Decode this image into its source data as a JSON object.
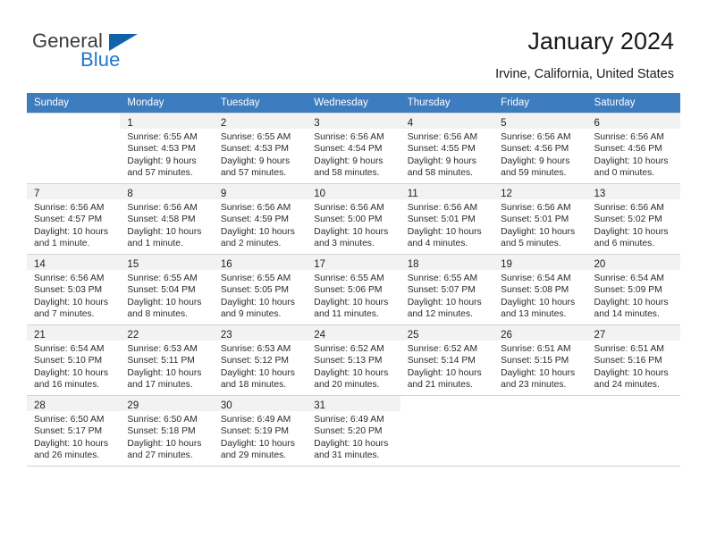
{
  "brand": {
    "name_part1": "General",
    "name_part2": "Blue",
    "flag_icon": "blue-flag-icon"
  },
  "header": {
    "title": "January 2024",
    "location": "Irvine, California, United States"
  },
  "calendar": {
    "weekday_headers": [
      "Sunday",
      "Monday",
      "Tuesday",
      "Wednesday",
      "Thursday",
      "Friday",
      "Saturday"
    ],
    "accent_color": "#3d7cbf",
    "weeks": [
      [
        {
          "day": "",
          "lines": []
        },
        {
          "day": "1",
          "lines": [
            "Sunrise: 6:55 AM",
            "Sunset: 4:53 PM",
            "Daylight: 9 hours",
            "and 57 minutes."
          ]
        },
        {
          "day": "2",
          "lines": [
            "Sunrise: 6:55 AM",
            "Sunset: 4:53 PM",
            "Daylight: 9 hours",
            "and 57 minutes."
          ]
        },
        {
          "day": "3",
          "lines": [
            "Sunrise: 6:56 AM",
            "Sunset: 4:54 PM",
            "Daylight: 9 hours",
            "and 58 minutes."
          ]
        },
        {
          "day": "4",
          "lines": [
            "Sunrise: 6:56 AM",
            "Sunset: 4:55 PM",
            "Daylight: 9 hours",
            "and 58 minutes."
          ]
        },
        {
          "day": "5",
          "lines": [
            "Sunrise: 6:56 AM",
            "Sunset: 4:56 PM",
            "Daylight: 9 hours",
            "and 59 minutes."
          ]
        },
        {
          "day": "6",
          "lines": [
            "Sunrise: 6:56 AM",
            "Sunset: 4:56 PM",
            "Daylight: 10 hours",
            "and 0 minutes."
          ]
        }
      ],
      [
        {
          "day": "7",
          "lines": [
            "Sunrise: 6:56 AM",
            "Sunset: 4:57 PM",
            "Daylight: 10 hours",
            "and 1 minute."
          ]
        },
        {
          "day": "8",
          "lines": [
            "Sunrise: 6:56 AM",
            "Sunset: 4:58 PM",
            "Daylight: 10 hours",
            "and 1 minute."
          ]
        },
        {
          "day": "9",
          "lines": [
            "Sunrise: 6:56 AM",
            "Sunset: 4:59 PM",
            "Daylight: 10 hours",
            "and 2 minutes."
          ]
        },
        {
          "day": "10",
          "lines": [
            "Sunrise: 6:56 AM",
            "Sunset: 5:00 PM",
            "Daylight: 10 hours",
            "and 3 minutes."
          ]
        },
        {
          "day": "11",
          "lines": [
            "Sunrise: 6:56 AM",
            "Sunset: 5:01 PM",
            "Daylight: 10 hours",
            "and 4 minutes."
          ]
        },
        {
          "day": "12",
          "lines": [
            "Sunrise: 6:56 AM",
            "Sunset: 5:01 PM",
            "Daylight: 10 hours",
            "and 5 minutes."
          ]
        },
        {
          "day": "13",
          "lines": [
            "Sunrise: 6:56 AM",
            "Sunset: 5:02 PM",
            "Daylight: 10 hours",
            "and 6 minutes."
          ]
        }
      ],
      [
        {
          "day": "14",
          "lines": [
            "Sunrise: 6:56 AM",
            "Sunset: 5:03 PM",
            "Daylight: 10 hours",
            "and 7 minutes."
          ]
        },
        {
          "day": "15",
          "lines": [
            "Sunrise: 6:55 AM",
            "Sunset: 5:04 PM",
            "Daylight: 10 hours",
            "and 8 minutes."
          ]
        },
        {
          "day": "16",
          "lines": [
            "Sunrise: 6:55 AM",
            "Sunset: 5:05 PM",
            "Daylight: 10 hours",
            "and 9 minutes."
          ]
        },
        {
          "day": "17",
          "lines": [
            "Sunrise: 6:55 AM",
            "Sunset: 5:06 PM",
            "Daylight: 10 hours",
            "and 11 minutes."
          ]
        },
        {
          "day": "18",
          "lines": [
            "Sunrise: 6:55 AM",
            "Sunset: 5:07 PM",
            "Daylight: 10 hours",
            "and 12 minutes."
          ]
        },
        {
          "day": "19",
          "lines": [
            "Sunrise: 6:54 AM",
            "Sunset: 5:08 PM",
            "Daylight: 10 hours",
            "and 13 minutes."
          ]
        },
        {
          "day": "20",
          "lines": [
            "Sunrise: 6:54 AM",
            "Sunset: 5:09 PM",
            "Daylight: 10 hours",
            "and 14 minutes."
          ]
        }
      ],
      [
        {
          "day": "21",
          "lines": [
            "Sunrise: 6:54 AM",
            "Sunset: 5:10 PM",
            "Daylight: 10 hours",
            "and 16 minutes."
          ]
        },
        {
          "day": "22",
          "lines": [
            "Sunrise: 6:53 AM",
            "Sunset: 5:11 PM",
            "Daylight: 10 hours",
            "and 17 minutes."
          ]
        },
        {
          "day": "23",
          "lines": [
            "Sunrise: 6:53 AM",
            "Sunset: 5:12 PM",
            "Daylight: 10 hours",
            "and 18 minutes."
          ]
        },
        {
          "day": "24",
          "lines": [
            "Sunrise: 6:52 AM",
            "Sunset: 5:13 PM",
            "Daylight: 10 hours",
            "and 20 minutes."
          ]
        },
        {
          "day": "25",
          "lines": [
            "Sunrise: 6:52 AM",
            "Sunset: 5:14 PM",
            "Daylight: 10 hours",
            "and 21 minutes."
          ]
        },
        {
          "day": "26",
          "lines": [
            "Sunrise: 6:51 AM",
            "Sunset: 5:15 PM",
            "Daylight: 10 hours",
            "and 23 minutes."
          ]
        },
        {
          "day": "27",
          "lines": [
            "Sunrise: 6:51 AM",
            "Sunset: 5:16 PM",
            "Daylight: 10 hours",
            "and 24 minutes."
          ]
        }
      ],
      [
        {
          "day": "28",
          "lines": [
            "Sunrise: 6:50 AM",
            "Sunset: 5:17 PM",
            "Daylight: 10 hours",
            "and 26 minutes."
          ]
        },
        {
          "day": "29",
          "lines": [
            "Sunrise: 6:50 AM",
            "Sunset: 5:18 PM",
            "Daylight: 10 hours",
            "and 27 minutes."
          ]
        },
        {
          "day": "30",
          "lines": [
            "Sunrise: 6:49 AM",
            "Sunset: 5:19 PM",
            "Daylight: 10 hours",
            "and 29 minutes."
          ]
        },
        {
          "day": "31",
          "lines": [
            "Sunrise: 6:49 AM",
            "Sunset: 5:20 PM",
            "Daylight: 10 hours",
            "and 31 minutes."
          ]
        },
        {
          "day": "",
          "lines": []
        },
        {
          "day": "",
          "lines": []
        },
        {
          "day": "",
          "lines": []
        }
      ]
    ]
  }
}
